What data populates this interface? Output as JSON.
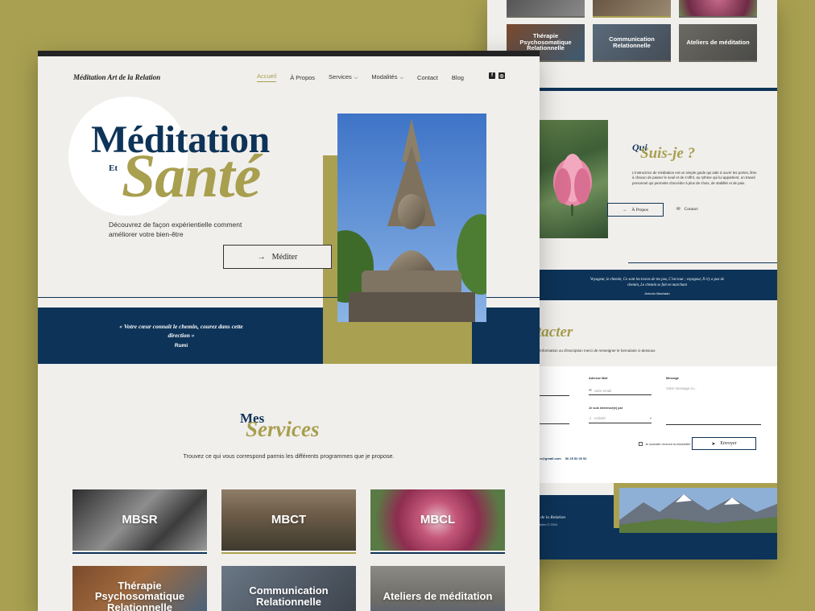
{
  "colors": {
    "navy": "#0d3358",
    "olive": "#a89f4f",
    "background": "#a9a151",
    "page": "#f1efec"
  },
  "front": {
    "logo": "Méditation Art de la Relation",
    "nav": [
      {
        "label": "Accueil",
        "active": true
      },
      {
        "label": "À Propos"
      },
      {
        "label": "Services",
        "dropdown": true
      },
      {
        "label": "Modalités",
        "dropdown": true
      },
      {
        "label": "Contact"
      },
      {
        "label": "Blog"
      }
    ],
    "social": [
      {
        "icon": "facebook-icon",
        "glyph": "f"
      },
      {
        "icon": "instagram-icon",
        "glyph": "◎"
      }
    ],
    "hero": {
      "title_line1": "Méditation",
      "title_et": "Et",
      "title_line2": "Santé",
      "intro": "Découvrez de façon expérientielle comment améliorer votre bien-être",
      "cta_arrow": "→",
      "cta": "Méditer"
    },
    "quote": {
      "text": "« Votre cœur connaît le chemin, courez dans cette direction »",
      "author": "Rumi"
    },
    "services": {
      "title_mes": "Mes",
      "title_services": "Services",
      "subtitle": "Trouvez ce qui vous correspond parmis les différents programmes que je propose.",
      "cards": [
        {
          "label": "MBSR"
        },
        {
          "label": "MBCT"
        },
        {
          "label": "MBCL"
        },
        {
          "label": "Thérapie Psychosomatique Relationnelle"
        },
        {
          "label": "Communication Relationnelle"
        },
        {
          "label": "Ateliers de méditation"
        }
      ]
    }
  },
  "back": {
    "cards": [
      {
        "label": "Thérapie Psychosomatique Relationnelle"
      },
      {
        "label": "Communication Relationnelle"
      },
      {
        "label": "Ateliers de méditation"
      }
    ],
    "about": {
      "title_qui": "Qui",
      "title_suisje": "Suis-je ?",
      "text": "L'instructrice de méditation est un simple guide qui aide à ouvrir les portes, libre à chacun de passer le seuil et de s'offrir, au rythme qui lui appartient, un travail personnel qui permette d'accéder à plus de choix, de stabilité et de paix.",
      "button_arrow": "→",
      "button": "À Propos",
      "contact_icon": "✉",
      "contact": "Contact"
    },
    "quote": {
      "text": "Voyageur, le chemin, Ce sont les traces de tes pas, C'est tout ; voyageur, Il n'y a pas de chemin, Le chemin se fait en marchant",
      "author": "Antonio Machado"
    },
    "contact": {
      "title": "tacter",
      "text": "d'information ou d'inscription merci de renseigner le formulaire ci-dessous",
      "email_label": "Adresse Mail",
      "email_icon": "✉",
      "email_placeholder": "votre email",
      "message_label": "Message",
      "message_placeholder": "Votre message ici...",
      "interest_label": "Je suis intéressé(e) par",
      "interest_icon": "⇓",
      "interest_value": "Activité",
      "checkbox_label": "Je souhaite recevoir la newsletter",
      "send_arrow": "➤",
      "send": "Envoyer",
      "phone": "06 25 52 00 52",
      "email_fragment": "ion@gmail.com"
    },
    "footer": {
      "title": "n de la Relation",
      "subtitle": "Fabien © 2024"
    }
  }
}
